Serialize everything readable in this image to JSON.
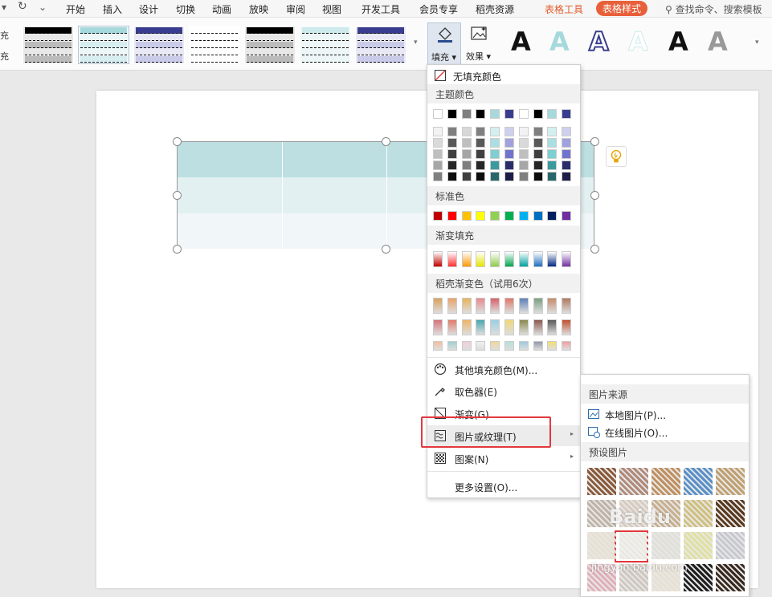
{
  "menubar": {
    "tabs": [
      "开始",
      "插入",
      "设计",
      "切换",
      "动画",
      "放映",
      "审阅",
      "视图",
      "开发工具",
      "会员专享",
      "稻壳资源"
    ],
    "context_tabs": [
      "表格工具",
      "表格样式"
    ],
    "search_label": "查找命令、搜索模板"
  },
  "ribbon": {
    "side_labels": [
      "充",
      "充"
    ],
    "fill_label": "填充",
    "effect_label": "效果",
    "text_art": [
      "A",
      "A",
      "A",
      "A",
      "A",
      "A"
    ]
  },
  "fill_menu": {
    "no_fill": "无填充颜色",
    "theme_colors": "主题颜色",
    "standard_colors": "标准色",
    "gradient_fill": "渐变填充",
    "docer_gradient": "稻壳渐变色（试用6次）",
    "more_colors": "其他填充颜色(M)...",
    "eyedropper": "取色器(E)",
    "gradient": "渐变(G)",
    "picture_texture": "图片或纹理(T)",
    "pattern": "图案(N)",
    "more_settings": "更多设置(O)...",
    "theme_top": [
      "#ffffff",
      "#000000",
      "#7f7f7f",
      "#000000",
      "#a6d9dc",
      "#3a3d8f",
      "#ffffff",
      "#000000",
      "#a6d9dc",
      "#3a3d8f"
    ],
    "standard": [
      "#c00000",
      "#ff0000",
      "#ffc000",
      "#ffff00",
      "#92d050",
      "#00b050",
      "#00b0f0",
      "#0070c0",
      "#002060",
      "#7030a0"
    ],
    "gradients": [
      "#c00000",
      "#ff3030",
      "#ff9900",
      "#e6e600",
      "#8fcc4a",
      "#00a651",
      "#00a0a0",
      "#1f6fc0",
      "#002a80",
      "#7030a0"
    ]
  },
  "submenu": {
    "source_header": "图片来源",
    "local_picture": "本地图片(P)...",
    "online_picture": "在线图片(O)...",
    "preset_header": "预设图片"
  },
  "watermark": {
    "logo": "Baidu",
    "site": "jingyan.baidu.com"
  }
}
